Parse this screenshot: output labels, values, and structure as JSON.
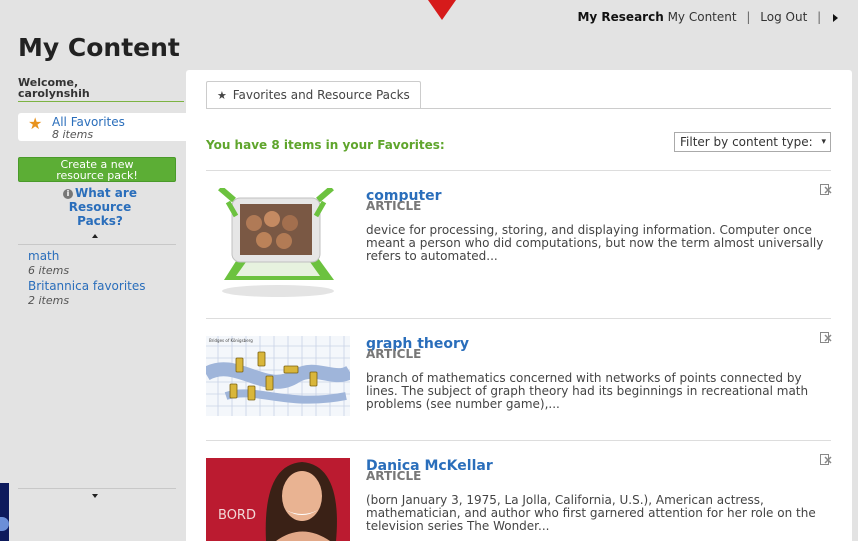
{
  "header": {
    "my_research": "My Research",
    "my_content": "My Content",
    "separator": "|",
    "log_out": "Log Out"
  },
  "page_title": "My Content",
  "sidebar": {
    "welcome_line1": "Welcome,",
    "username": "carolynshih",
    "all_favorites_label": "All Favorites",
    "all_favorites_count": "8 items",
    "create_pack_line1": "Create a new",
    "create_pack_line2": "resource pack!",
    "what_are_packs_line1": "What are Resource",
    "what_are_packs_line2": "Packs?",
    "packs": [
      {
        "name": "math",
        "count": "6 items"
      },
      {
        "name": "Britannica favorites",
        "count": "2 items"
      }
    ]
  },
  "main": {
    "tab_label": "Favorites and Resource Packs",
    "count_text": "You have 8 items in your Favorites:",
    "filter_placeholder": "Filter by content type:",
    "items": [
      {
        "title": "computer",
        "type": "ARTICLE",
        "description": "device for processing, storing, and displaying information. Computer once meant a person who did computations, but now the term almost universally refers to automated..."
      },
      {
        "title": "graph theory",
        "type": "ARTICLE",
        "description": "branch of mathematics concerned with networks of points connected by lines. The subject of graph theory had its beginnings in recreational math problems (see number game),...",
        "thumb_caption": "Bridges of Königsberg"
      },
      {
        "title": "Danica McKellar",
        "type": "ARTICLE",
        "description": "(born January 3, 1975, La Jolla, California, U.S.), American actress, mathematician, and author who first garnered attention for her role on the television series The Wonder...",
        "thumb_text": "BORD"
      }
    ]
  },
  "colors": {
    "accent_green": "#5fa52c",
    "link_blue": "#2a6ebb",
    "star_orange": "#e8931e",
    "arrow_red": "#d61b1b"
  }
}
